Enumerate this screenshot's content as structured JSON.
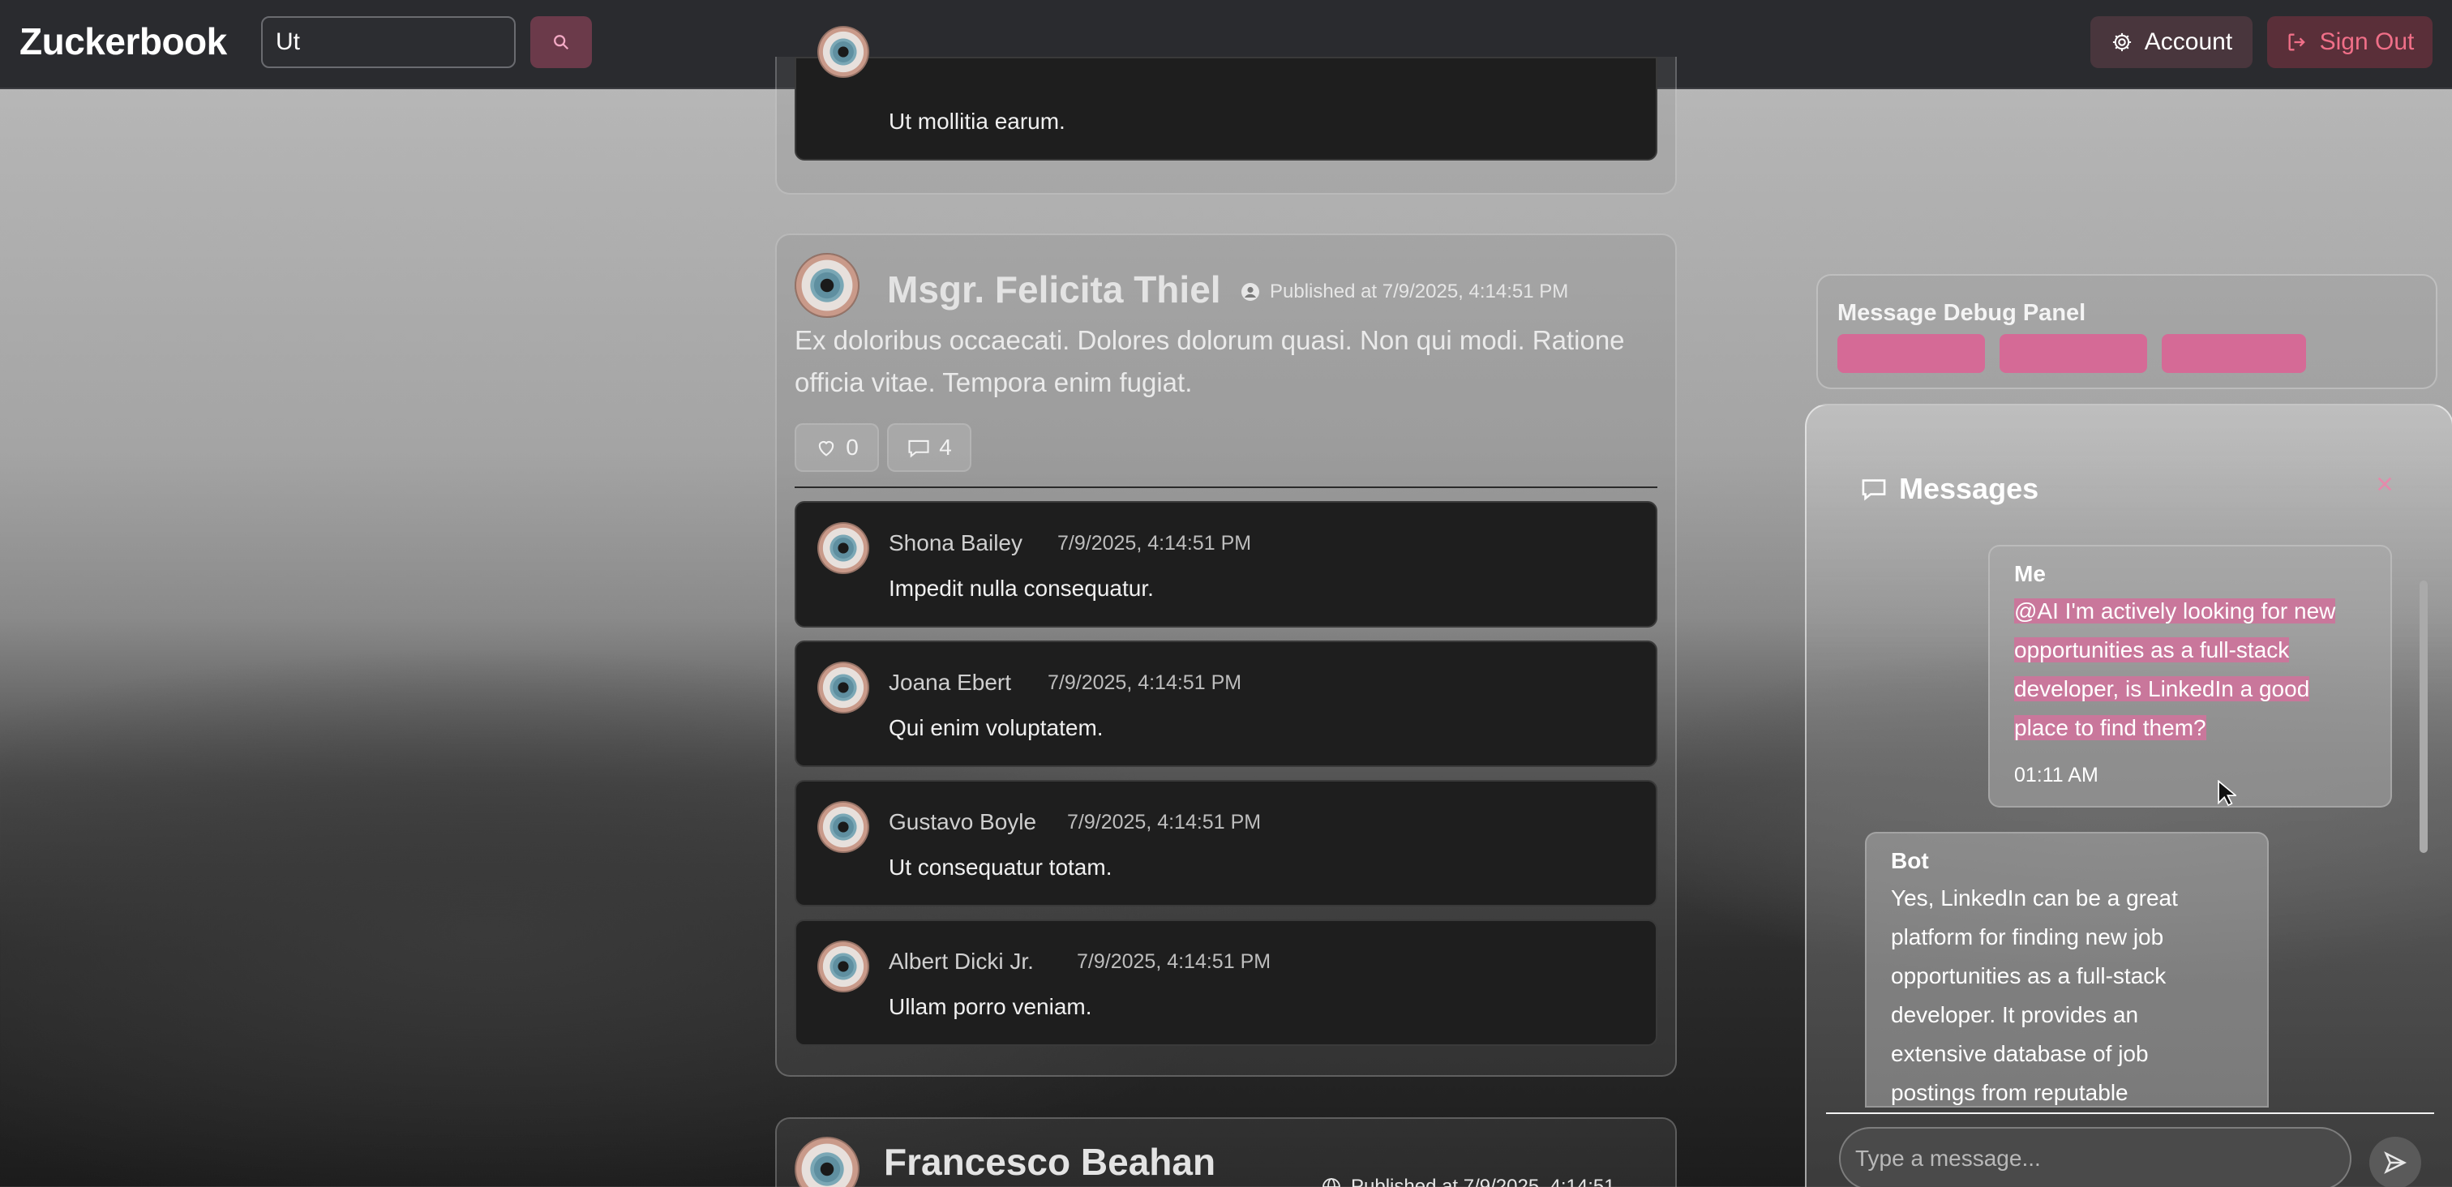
{
  "header": {
    "brand": "Zuckerbook",
    "search_value": "Ut",
    "account_label": "Account",
    "signout_label": "Sign Out"
  },
  "top_card": {
    "comment_text": "Ut mollitia earum."
  },
  "post": {
    "author": "Msgr. Felicita Thiel",
    "published": "Published at 7/9/2025, 4:14:51 PM",
    "body": "Ex doloribus occaecati. Dolores dolorum quasi. Non qui modi. Ratione officia vitae. Tempora enim fugiat.",
    "likes": "0",
    "comments_count": "4",
    "comments": [
      {
        "name": "Shona Bailey",
        "time": "7/9/2025, 4:14:51 PM",
        "text": "Impedit nulla consequatur."
      },
      {
        "name": "Joana Ebert",
        "time": "7/9/2025, 4:14:51 PM",
        "text": "Qui enim voluptatem."
      },
      {
        "name": "Gustavo Boyle",
        "time": "7/9/2025, 4:14:51 PM",
        "text": "Ut consequatur totam."
      },
      {
        "name": "Albert Dicki Jr.",
        "time": "7/9/2025, 4:14:51 PM",
        "text": "Ullam porro veniam."
      }
    ]
  },
  "next_post": {
    "author": "Francesco Beahan",
    "published": "Published at 7/9/2025, 4:14:51"
  },
  "debug_panel": {
    "title": "Message Debug Panel"
  },
  "messages": {
    "title": "Messages",
    "me": {
      "sender": "Me",
      "lines": [
        "@AI I'm actively looking for new",
        "opportunities as a full-stack",
        "developer, is LinkedIn a good",
        "place to find them?"
      ],
      "time": "01:11 AM"
    },
    "bot": {
      "sender": "Bot",
      "lines": [
        "Yes, LinkedIn can be a great",
        "platform for finding new job",
        "opportunities as a full-stack",
        "developer. It provides an",
        "extensive database of job",
        "postings from reputable"
      ]
    },
    "input_placeholder": "Type a message..."
  },
  "colors": {
    "accent_pink": "#d56a96",
    "signout_text": "#f06f88",
    "topbar": "#2a2b2f"
  }
}
